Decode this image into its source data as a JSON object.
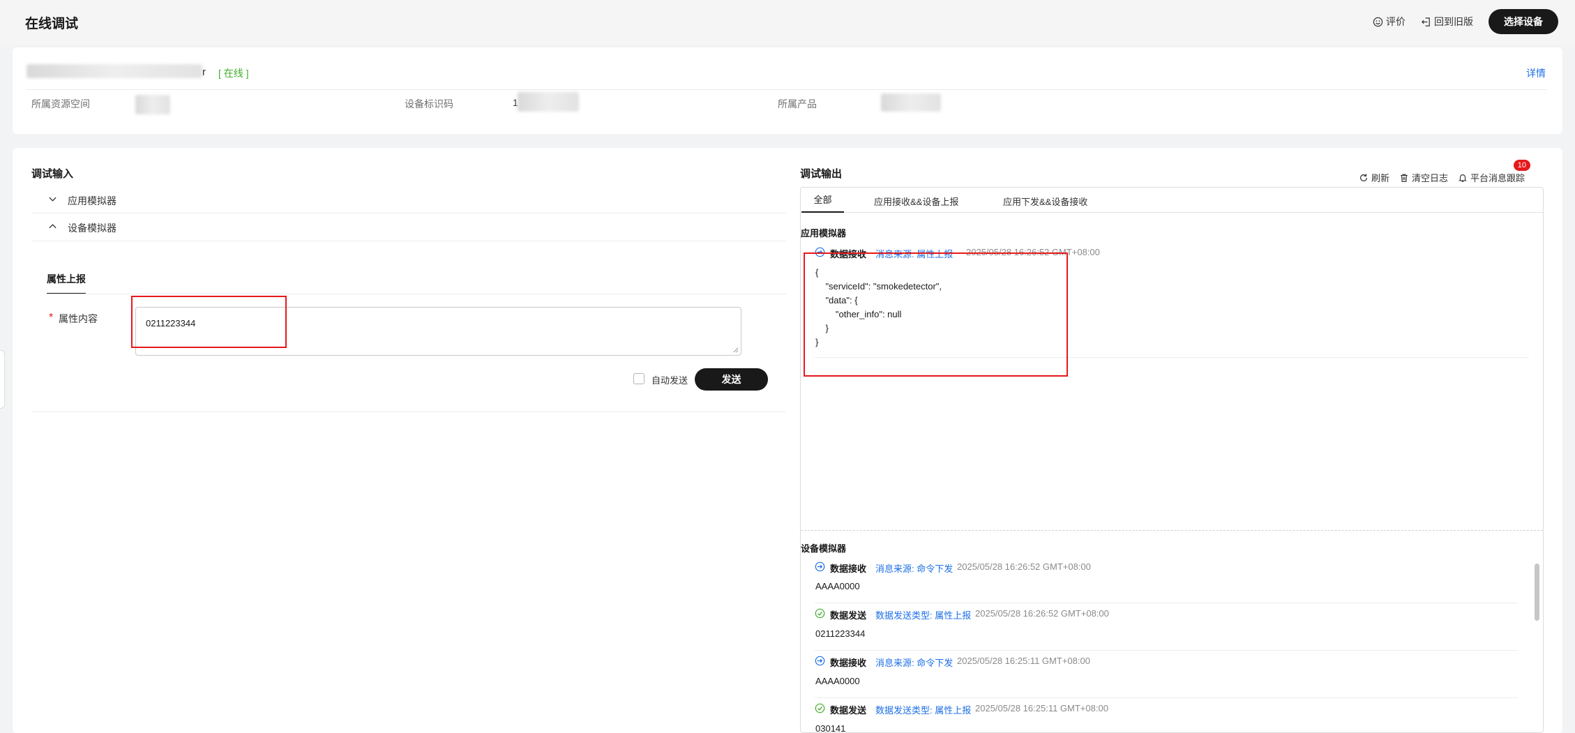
{
  "header": {
    "title": "在线调试",
    "rate_label": "评价",
    "old_version_label": "回到旧版",
    "select_device_label": "选择设备"
  },
  "device": {
    "name_suffix": "r",
    "status": "[ 在线 ]",
    "details_link": "详情",
    "resource_space_label": "所属资源空间",
    "device_id_label": "设备标识码",
    "device_id_prefix": "1",
    "product_label": "所属产品"
  },
  "input_panel": {
    "title": "调试输入",
    "app_simulator": "应用模拟器",
    "device_simulator": "设备模拟器",
    "tab_property_report": "属性上报",
    "required_mark": "*",
    "field_label": "属性内容",
    "field_value": "0211223344",
    "auto_send_label": "自动发送",
    "send_button": "发送"
  },
  "output_panel": {
    "title": "调试输出",
    "refresh_label": "刷新",
    "clear_log_label": "清空日志",
    "platform_trace_label": "平台消息跟踪",
    "trace_badge": "10",
    "tabs": [
      "全部",
      "应用接收&&设备上报",
      "应用下发&&设备接收"
    ],
    "app_section_title": "应用模拟器",
    "app_entry": {
      "type": "数据接收",
      "source": "消息来源: 属性上报",
      "time": "2025/05/28 16:26:52 GMT+08:00",
      "json_lines": [
        "{",
        "    \"serviceId\": \"smokedetector\",",
        "    \"data\": {",
        "        \"other_info\": null",
        "    }",
        "}"
      ]
    },
    "device_section_title": "设备模拟器",
    "device_entries": [
      {
        "type": "数据接收",
        "source": "消息来源: 命令下发",
        "time": "2025/05/28 16:26:52 GMT+08:00",
        "value": "AAAA0000"
      },
      {
        "type": "数据发送",
        "source": "数据发送类型: 属性上报",
        "time": "2025/05/28 16:26:52 GMT+08:00",
        "value": "0211223344"
      },
      {
        "type": "数据接收",
        "source": "消息来源: 命令下发",
        "time": "2025/05/28 16:25:11 GMT+08:00",
        "value": "AAAA0000"
      },
      {
        "type": "数据发送",
        "source": "数据发送类型: 属性上报",
        "time": "2025/05/28 16:25:11 GMT+08:00",
        "value": "030141"
      }
    ]
  },
  "colors": {
    "accent": "#1e6fe6",
    "online": "#3fae29",
    "highlight": "#e5191c",
    "dark_button": "#191919"
  }
}
